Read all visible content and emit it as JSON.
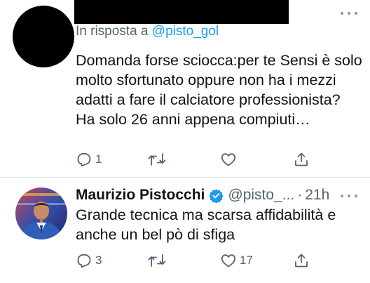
{
  "reply_tweet": {
    "reply_prefix": "In risposta a",
    "reply_mention": "@pisto_gol",
    "text": "Domanda forse sciocca:per te Sensi è solo molto sfortunato oppure non ha i mezzi adatti a fare il calciatore professionista? Ha solo 26 anni appena compiuti…",
    "reply_count": "1",
    "retweet_count": "",
    "like_count": "",
    "icons": [
      "reply-icon",
      "retweet-icon",
      "like-icon",
      "share-icon",
      "more-icon"
    ]
  },
  "main_tweet": {
    "display_name": "Maurizio Pistocchi",
    "handle": "@pisto_...",
    "separator": "·",
    "time": "21h",
    "text": "Grande tecnica ma scarsa affidabilità e anche un bel pò di sfiga",
    "reply_count": "3",
    "retweet_count": "",
    "like_count": "17",
    "icons": [
      "verified-badge-icon",
      "reply-icon",
      "retweet-icon",
      "like-icon",
      "share-icon",
      "more-icon"
    ]
  },
  "colors": {
    "accent": "#1d9bf0",
    "secondary_text": "#536471",
    "primary_text": "#0f1419",
    "icon": "#536471"
  }
}
